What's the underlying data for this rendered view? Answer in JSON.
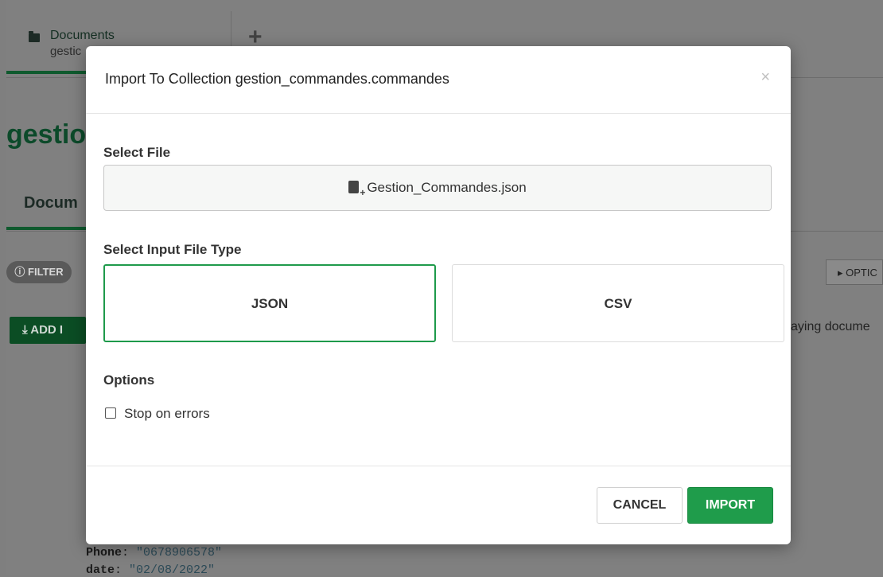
{
  "background": {
    "doc_tab_title": "Documents",
    "doc_tab_sub": "gestic",
    "new_tab_symbol": "+",
    "namespace_title": "gestio",
    "sub_tab_label": "Docum",
    "filter_label": "FILTER",
    "options_label": "▸ OPTIC",
    "add_data_label": "ADD I",
    "displaying_text": "aying docume",
    "code_lines": [
      {
        "key": "Phone",
        "value": "\"0678906578\""
      },
      {
        "key": "date",
        "value": "\"02/08/2022\""
      }
    ]
  },
  "modal": {
    "title": "Import To Collection gestion_commandes.commandes",
    "close_symbol": "×",
    "select_file_label": "Select File",
    "file_name": "Gestion_Commandes.json",
    "select_type_label": "Select Input File Type",
    "type_options": [
      "JSON",
      "CSV"
    ],
    "selected_type": "JSON",
    "options_label": "Options",
    "stop_on_errors_label": "Stop on errors",
    "stop_on_errors_checked": false,
    "cancel_label": "CANCEL",
    "import_label": "IMPORT"
  },
  "colors": {
    "accent_green": "#1f9c4b",
    "selected_border": "#1e9a4b",
    "overlay": "#808080"
  }
}
